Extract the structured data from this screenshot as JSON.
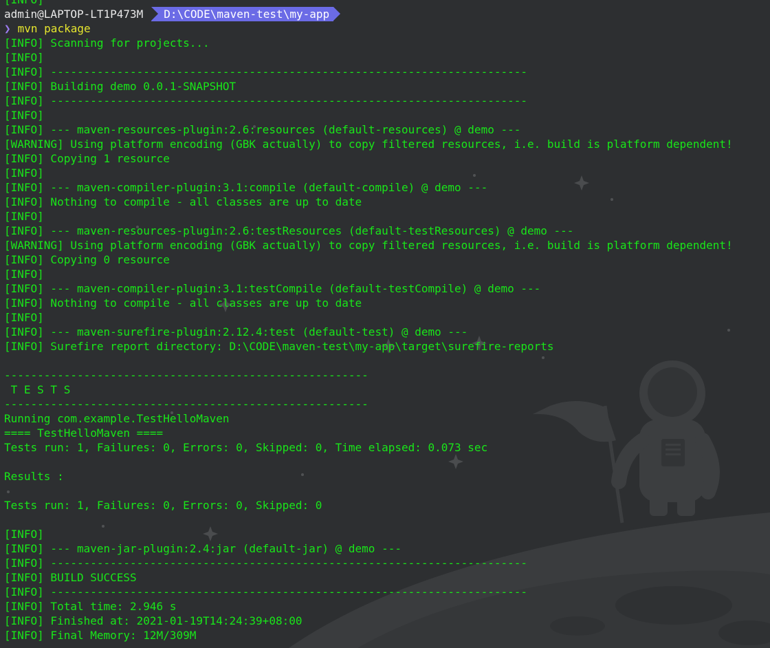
{
  "prompt": {
    "user_host": "admin@LAPTOP-LT1P473M",
    "path": "D:\\CODE\\maven-test\\my-app",
    "chevron": "❯",
    "command": "mvn package"
  },
  "colors": {
    "background": "#2d2f31",
    "output_text": "#19e619",
    "command_text": "#e6e62e",
    "path_segment": "#6b6be6",
    "chevron": "#9d7cf0"
  },
  "output_lines": [
    "[INFO] Scanning for projects...",
    "[INFO]",
    "[INFO] ------------------------------------------------------------------------",
    "[INFO] Building demo 0.0.1-SNAPSHOT",
    "[INFO] ------------------------------------------------------------------------",
    "[INFO]",
    "[INFO] --- maven-resources-plugin:2.6:resources (default-resources) @ demo ---",
    "[WARNING] Using platform encoding (GBK actually) to copy filtered resources, i.e. build is platform dependent!",
    "[INFO] Copying 1 resource",
    "[INFO]",
    "[INFO] --- maven-compiler-plugin:3.1:compile (default-compile) @ demo ---",
    "[INFO] Nothing to compile - all classes are up to date",
    "[INFO]",
    "[INFO] --- maven-resources-plugin:2.6:testResources (default-testResources) @ demo ---",
    "[WARNING] Using platform encoding (GBK actually) to copy filtered resources, i.e. build is platform dependent!",
    "[INFO] Copying 0 resource",
    "[INFO]",
    "[INFO] --- maven-compiler-plugin:3.1:testCompile (default-testCompile) @ demo ---",
    "[INFO] Nothing to compile - all classes are up to date",
    "[INFO]",
    "[INFO] --- maven-surefire-plugin:2.12.4:test (default-test) @ demo ---",
    "[INFO] Surefire report directory: D:\\CODE\\maven-test\\my-app\\target\\surefire-reports",
    "",
    "-------------------------------------------------------",
    " T E S T S",
    "-------------------------------------------------------",
    "Running com.example.TestHelloMaven",
    "==== TestHelloMaven ====",
    "Tests run: 1, Failures: 0, Errors: 0, Skipped: 0, Time elapsed: 0.073 sec",
    "",
    "Results :",
    "",
    "Tests run: 1, Failures: 0, Errors: 0, Skipped: 0",
    "",
    "[INFO]",
    "[INFO] --- maven-jar-plugin:2.4:jar (default-jar) @ demo ---",
    "[INFO] ------------------------------------------------------------------------",
    "[INFO] BUILD SUCCESS",
    "[INFO] ------------------------------------------------------------------------",
    "[INFO] Total time: 2.946 s",
    "[INFO] Finished at: 2021-01-19T14:24:39+08:00",
    "[INFO] Final Memory: 12M/309M"
  ]
}
